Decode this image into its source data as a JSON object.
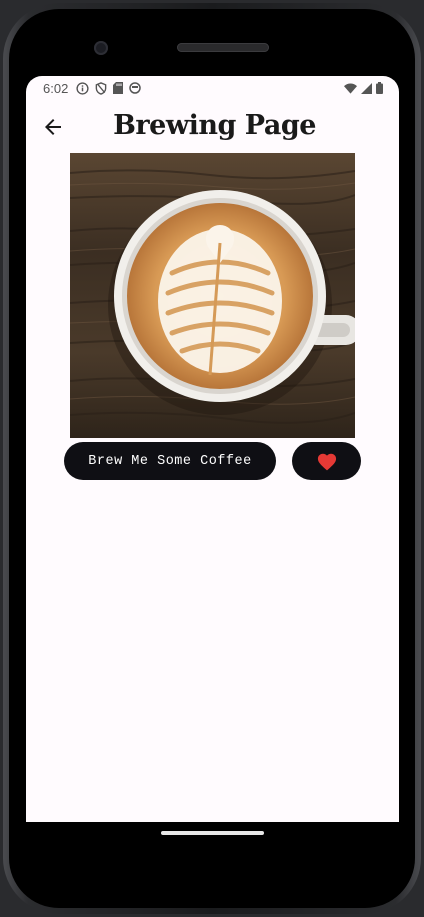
{
  "status_bar": {
    "time": "6:02",
    "left_icons": [
      "info-icon",
      "shield-icon",
      "sd-card-icon",
      "app-icon"
    ],
    "right_icons": [
      "wifi-icon",
      "signal-icon",
      "battery-icon"
    ]
  },
  "app_bar": {
    "back_icon": "arrow-back-icon",
    "title": "Brewing Page"
  },
  "main": {
    "image_subject": "latte-art-coffee-cup",
    "brew_button_label": "Brew Me Some Coffee",
    "favorite_icon": "heart-icon"
  },
  "colors": {
    "screen_bg": "#fffbfe",
    "button_bg": "#0f0f14",
    "button_text": "#ffffff",
    "heart": "#e53935",
    "title": "#1a1a1a"
  }
}
